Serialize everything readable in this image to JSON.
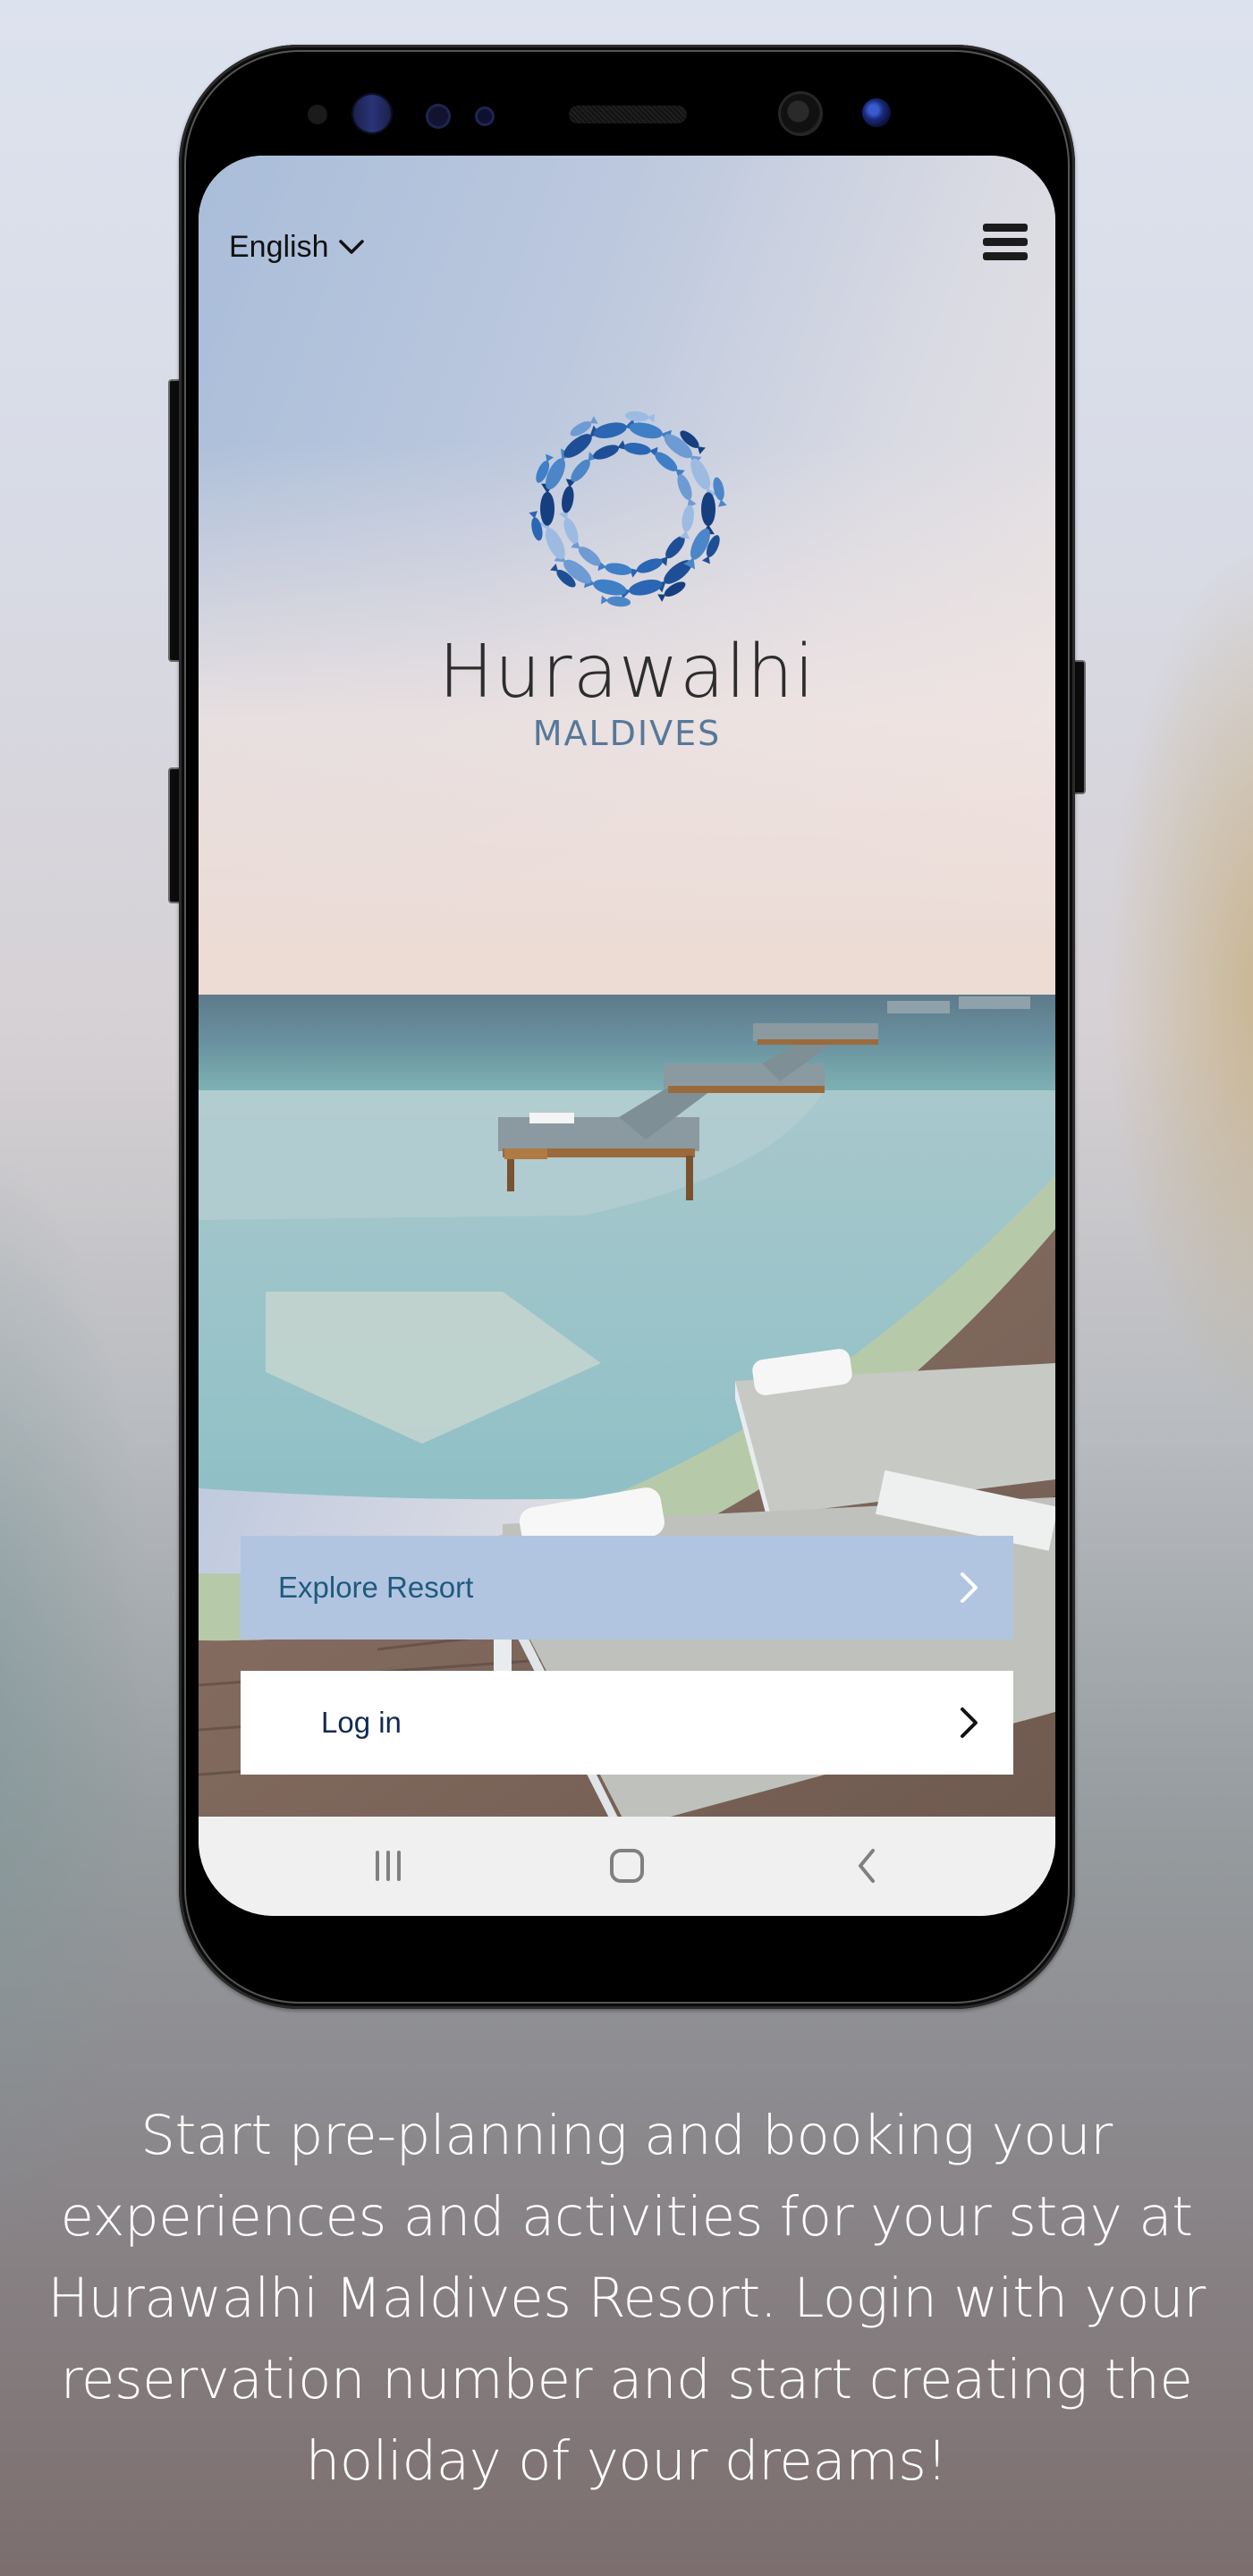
{
  "app": {
    "language_selector": {
      "label": "English",
      "icon": "chevron-down-icon"
    },
    "menu_icon": "hamburger-menu-icon",
    "brand": {
      "name": "Hurawalhi",
      "subtitle": "MALDIVES",
      "logo_icon": "fish-circle-logo"
    },
    "buttons": [
      {
        "label": "Explore Resort",
        "icon": "chevron-right-icon"
      },
      {
        "label": "Log in",
        "icon": "chevron-right-icon"
      }
    ],
    "navbar": [
      {
        "name": "recent-apps",
        "icon": "recent-apps-icon"
      },
      {
        "name": "home",
        "icon": "home-icon"
      },
      {
        "name": "back",
        "icon": "back-icon"
      }
    ]
  },
  "caption": "Start pre-planning and booking your experiences and activities for your stay at Hurawalhi Maldives Resort. Login with your reservation number and start creating the holiday of your dreams!",
  "colors": {
    "explore_button_bg": "#b2c5e0",
    "explore_button_text": "#1f5a7e",
    "login_button_bg": "#ffffff",
    "login_button_text": "#0f2a52",
    "brand_subtitle": "#56789a",
    "navbar_bg": "#f0f0f0"
  }
}
